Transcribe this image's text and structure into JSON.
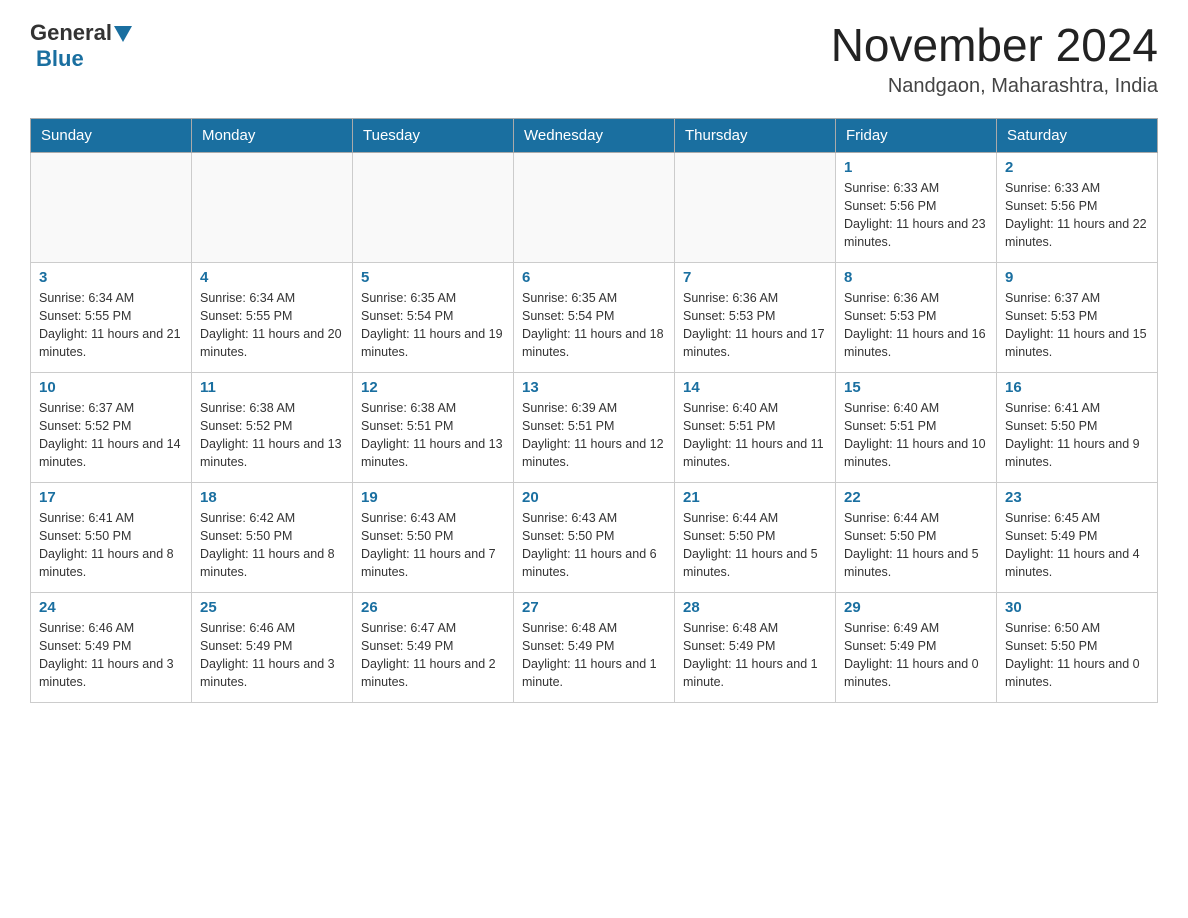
{
  "logo": {
    "general": "General",
    "blue": "Blue"
  },
  "title": "November 2024",
  "location": "Nandgaon, Maharashtra, India",
  "weekdays": [
    "Sunday",
    "Monday",
    "Tuesday",
    "Wednesday",
    "Thursday",
    "Friday",
    "Saturday"
  ],
  "weeks": [
    [
      {
        "day": "",
        "info": ""
      },
      {
        "day": "",
        "info": ""
      },
      {
        "day": "",
        "info": ""
      },
      {
        "day": "",
        "info": ""
      },
      {
        "day": "",
        "info": ""
      },
      {
        "day": "1",
        "info": "Sunrise: 6:33 AM\nSunset: 5:56 PM\nDaylight: 11 hours and 23 minutes."
      },
      {
        "day": "2",
        "info": "Sunrise: 6:33 AM\nSunset: 5:56 PM\nDaylight: 11 hours and 22 minutes."
      }
    ],
    [
      {
        "day": "3",
        "info": "Sunrise: 6:34 AM\nSunset: 5:55 PM\nDaylight: 11 hours and 21 minutes."
      },
      {
        "day": "4",
        "info": "Sunrise: 6:34 AM\nSunset: 5:55 PM\nDaylight: 11 hours and 20 minutes."
      },
      {
        "day": "5",
        "info": "Sunrise: 6:35 AM\nSunset: 5:54 PM\nDaylight: 11 hours and 19 minutes."
      },
      {
        "day": "6",
        "info": "Sunrise: 6:35 AM\nSunset: 5:54 PM\nDaylight: 11 hours and 18 minutes."
      },
      {
        "day": "7",
        "info": "Sunrise: 6:36 AM\nSunset: 5:53 PM\nDaylight: 11 hours and 17 minutes."
      },
      {
        "day": "8",
        "info": "Sunrise: 6:36 AM\nSunset: 5:53 PM\nDaylight: 11 hours and 16 minutes."
      },
      {
        "day": "9",
        "info": "Sunrise: 6:37 AM\nSunset: 5:53 PM\nDaylight: 11 hours and 15 minutes."
      }
    ],
    [
      {
        "day": "10",
        "info": "Sunrise: 6:37 AM\nSunset: 5:52 PM\nDaylight: 11 hours and 14 minutes."
      },
      {
        "day": "11",
        "info": "Sunrise: 6:38 AM\nSunset: 5:52 PM\nDaylight: 11 hours and 13 minutes."
      },
      {
        "day": "12",
        "info": "Sunrise: 6:38 AM\nSunset: 5:51 PM\nDaylight: 11 hours and 13 minutes."
      },
      {
        "day": "13",
        "info": "Sunrise: 6:39 AM\nSunset: 5:51 PM\nDaylight: 11 hours and 12 minutes."
      },
      {
        "day": "14",
        "info": "Sunrise: 6:40 AM\nSunset: 5:51 PM\nDaylight: 11 hours and 11 minutes."
      },
      {
        "day": "15",
        "info": "Sunrise: 6:40 AM\nSunset: 5:51 PM\nDaylight: 11 hours and 10 minutes."
      },
      {
        "day": "16",
        "info": "Sunrise: 6:41 AM\nSunset: 5:50 PM\nDaylight: 11 hours and 9 minutes."
      }
    ],
    [
      {
        "day": "17",
        "info": "Sunrise: 6:41 AM\nSunset: 5:50 PM\nDaylight: 11 hours and 8 minutes."
      },
      {
        "day": "18",
        "info": "Sunrise: 6:42 AM\nSunset: 5:50 PM\nDaylight: 11 hours and 8 minutes."
      },
      {
        "day": "19",
        "info": "Sunrise: 6:43 AM\nSunset: 5:50 PM\nDaylight: 11 hours and 7 minutes."
      },
      {
        "day": "20",
        "info": "Sunrise: 6:43 AM\nSunset: 5:50 PM\nDaylight: 11 hours and 6 minutes."
      },
      {
        "day": "21",
        "info": "Sunrise: 6:44 AM\nSunset: 5:50 PM\nDaylight: 11 hours and 5 minutes."
      },
      {
        "day": "22",
        "info": "Sunrise: 6:44 AM\nSunset: 5:50 PM\nDaylight: 11 hours and 5 minutes."
      },
      {
        "day": "23",
        "info": "Sunrise: 6:45 AM\nSunset: 5:49 PM\nDaylight: 11 hours and 4 minutes."
      }
    ],
    [
      {
        "day": "24",
        "info": "Sunrise: 6:46 AM\nSunset: 5:49 PM\nDaylight: 11 hours and 3 minutes."
      },
      {
        "day": "25",
        "info": "Sunrise: 6:46 AM\nSunset: 5:49 PM\nDaylight: 11 hours and 3 minutes."
      },
      {
        "day": "26",
        "info": "Sunrise: 6:47 AM\nSunset: 5:49 PM\nDaylight: 11 hours and 2 minutes."
      },
      {
        "day": "27",
        "info": "Sunrise: 6:48 AM\nSunset: 5:49 PM\nDaylight: 11 hours and 1 minute."
      },
      {
        "day": "28",
        "info": "Sunrise: 6:48 AM\nSunset: 5:49 PM\nDaylight: 11 hours and 1 minute."
      },
      {
        "day": "29",
        "info": "Sunrise: 6:49 AM\nSunset: 5:49 PM\nDaylight: 11 hours and 0 minutes."
      },
      {
        "day": "30",
        "info": "Sunrise: 6:50 AM\nSunset: 5:50 PM\nDaylight: 11 hours and 0 minutes."
      }
    ]
  ]
}
